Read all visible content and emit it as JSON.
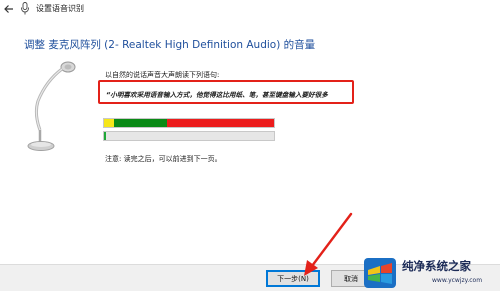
{
  "window": {
    "title": "设置语音识别",
    "back_icon": "back-arrow-icon",
    "app_icon": "microphone-icon"
  },
  "page": {
    "heading": "调整 麦克风阵列 (2- Realtek High Definition Audio) 的音量",
    "instruction": "以自然的说话声音大声朗读下列语句:",
    "sample_sentence": "“小明喜欢采用语音输入方式，他觉得这比用纸、笔，甚至键盘输入要好很多",
    "note": "注意: 读完之后，可以前进到下一页。"
  },
  "meters": {
    "level_segments": [
      {
        "color": "#f5e61a",
        "fraction": 0.06
      },
      {
        "color": "#0a8a16",
        "fraction": 0.31
      },
      {
        "color": "#ec1c1c",
        "fraction": 0.63
      }
    ],
    "progress": 0.01,
    "progress_color": "#1fa838"
  },
  "buttons": {
    "next": "下一步(N)",
    "cancel": "取消"
  },
  "colors": {
    "accent": "#1f4f9c",
    "highlight_border": "#e32119",
    "arrow": "#e32119"
  },
  "watermark": {
    "text": "纯净系统之家",
    "url": "www.ycwjzy.com"
  }
}
